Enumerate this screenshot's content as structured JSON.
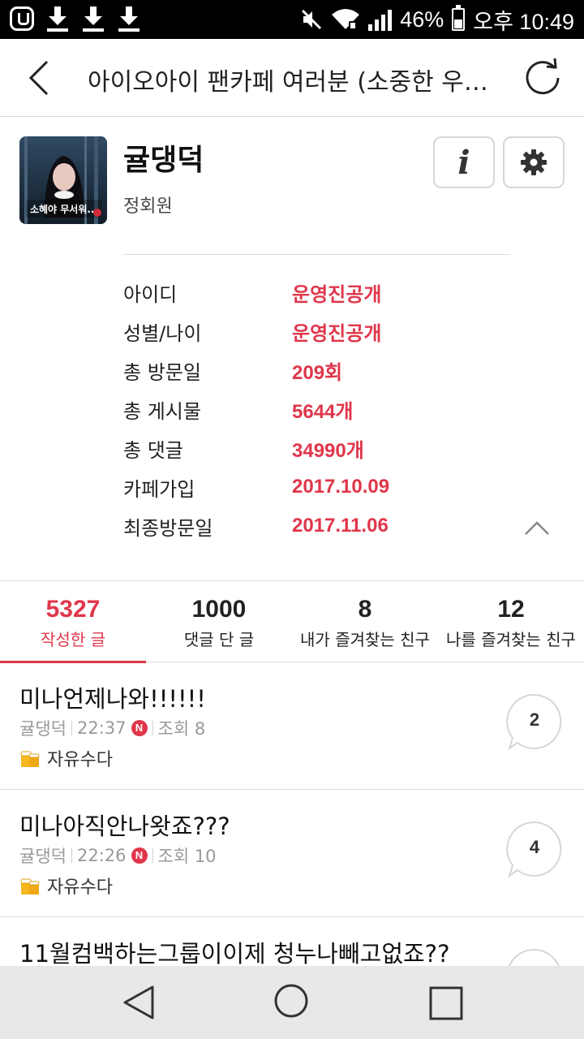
{
  "status_bar": {
    "battery": "46%",
    "time": "오후 10:49",
    "icons": [
      "app-icon",
      "download-icon",
      "download-icon",
      "download-icon",
      "mute-icon",
      "wifi-icon",
      "signal-icon",
      "battery-icon"
    ]
  },
  "header": {
    "title": "아이오아이 팬카페 여러분 (소중한 우…",
    "back_icon": "chevron-left-icon",
    "refresh_icon": "refresh-icon"
  },
  "profile": {
    "nickname": "귤댕덕",
    "grade": "정회원",
    "avatar_caption": "소혜야 무서워...",
    "info_button_label": "i",
    "settings_icon": "gear-icon",
    "details": [
      {
        "label": "아이디",
        "value": "운영진공개"
      },
      {
        "label": "성별/나이",
        "value": "운영진공개"
      },
      {
        "label": "총 방문일",
        "value": "209회"
      },
      {
        "label": "총 게시물",
        "value": "5644개"
      },
      {
        "label": "총 댓글",
        "value": "34990개"
      },
      {
        "label": "카페가입",
        "value": "2017.10.09"
      },
      {
        "label": "최종방문일",
        "value": "2017.11.06"
      }
    ]
  },
  "tabs": [
    {
      "count": "5327",
      "label": "작성한 글",
      "active": true
    },
    {
      "count": "1000",
      "label": "댓글 단 글",
      "active": false
    },
    {
      "count": "8",
      "label": "내가 즐겨찾는 친구",
      "active": false
    },
    {
      "count": "12",
      "label": "나를 즐겨찾는 친구",
      "active": false
    }
  ],
  "posts": [
    {
      "title": "미나언제나와!!!!!!",
      "author": "귤댕덕",
      "time": "22:37",
      "new_badge": "N",
      "views": "조회 8",
      "board": "자유수다",
      "comments": "2"
    },
    {
      "title": "미나아직안나왓죠???",
      "author": "귤댕덕",
      "time": "22:26",
      "new_badge": "N",
      "views": "조회 10",
      "board": "자유수다",
      "comments": "4"
    },
    {
      "title": "11월컴백하는그룹이이제 청누나빼고없죠??",
      "author": "",
      "time": "",
      "new_badge": "",
      "views": "",
      "board": "",
      "comments": ""
    }
  ],
  "colors": {
    "accent": "#e0364a",
    "divider": "#dcdcdc",
    "navbar": "#e8e8e8"
  }
}
